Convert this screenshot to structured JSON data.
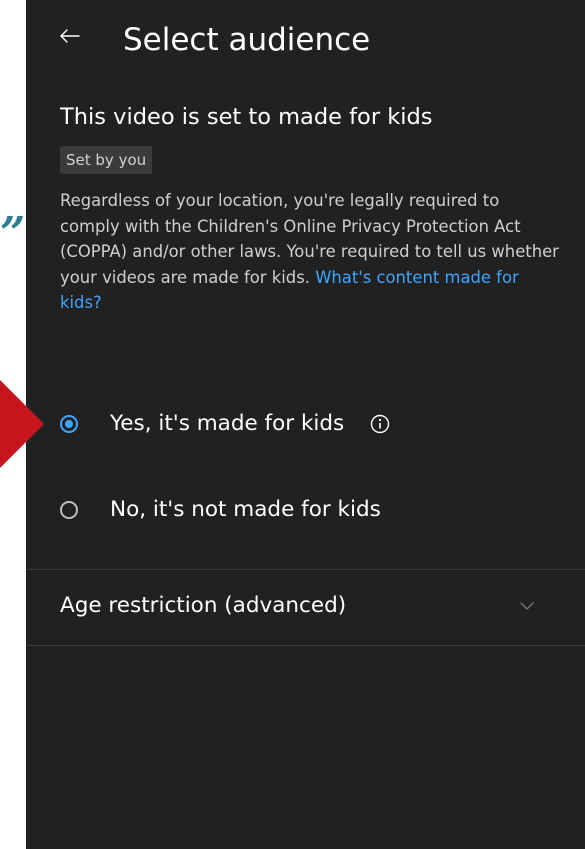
{
  "header": {
    "title": "Select audience",
    "back_icon": "back-arrow-icon"
  },
  "status": {
    "heading": "This video is set to made for kids",
    "badge": "Set by you"
  },
  "description": {
    "text": "Regardless of your location, you're legally required to comply with the Children's Online Privacy Protection Act (COPPA) and/or other laws. You're required to tell us whether your videos are made for kids.",
    "link": "What's content made for kids?"
  },
  "options": [
    {
      "label": "Yes, it's made for kids",
      "selected": true
    },
    {
      "label": "No, it's not made for kids",
      "selected": false
    }
  ],
  "age_restriction": {
    "label": "Age restriction (advanced)",
    "icon": "chevron-down-icon"
  },
  "colors": {
    "background": "#212121",
    "accent": "#3ea6ff",
    "pointer": "#c8171c",
    "quote": "#2f7d95"
  }
}
